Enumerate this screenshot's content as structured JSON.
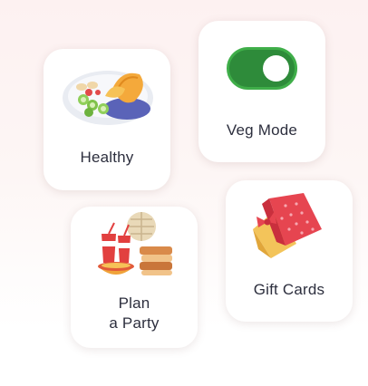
{
  "cards": {
    "healthy": {
      "label": "Healthy",
      "icon": "salad-bowl-icon"
    },
    "veg_mode": {
      "label": "Veg Mode",
      "icon": "toggle-switch-icon",
      "toggle_on": true,
      "toggle_color": "#2e8b3a"
    },
    "party": {
      "label_line1": "Plan",
      "label_line2": "a Party",
      "icon": "party-food-icon"
    },
    "gift": {
      "label": "Gift Cards",
      "icon": "gift-envelope-icon"
    }
  }
}
